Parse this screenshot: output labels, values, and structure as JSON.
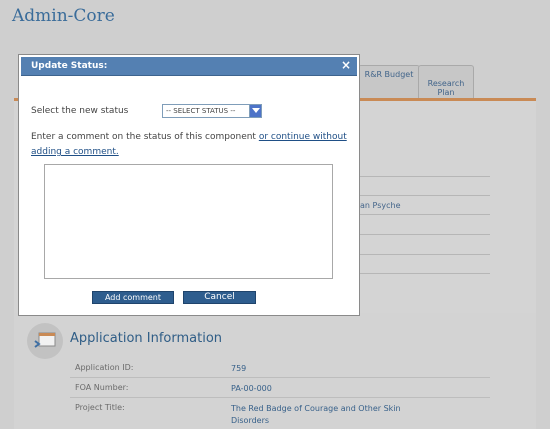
{
  "page": {
    "title": "Admin-Core",
    "tabs": [
      {
        "label": "R&R Budget"
      },
      {
        "label": "Research\nPlan"
      }
    ],
    "partial_text": "an Psyche"
  },
  "application_info": {
    "title": "Application Information",
    "rows": [
      {
        "label": "Application ID:",
        "value": "759"
      },
      {
        "label": "FOA Number:",
        "value": "PA-00-000"
      },
      {
        "label": "Project Title:",
        "value": "The Red Badge of Courage and Other Skin Disorders"
      }
    ]
  },
  "modal": {
    "title": "Update Status:",
    "close_icon": "close-icon",
    "status_label": "Select the new status",
    "status_selected": "-- SELECT STATUS --",
    "comment_prompt": "Enter a comment on the status of this component ",
    "comment_link": "or continue without adding a comment.",
    "comment_value": "",
    "add_button": "Add comment",
    "cancel_button": "Cancel"
  },
  "colors": {
    "header": "#5480b2",
    "button": "#2e5d8e",
    "accent_strip": "#c98a55",
    "link": "#1f4f86"
  }
}
